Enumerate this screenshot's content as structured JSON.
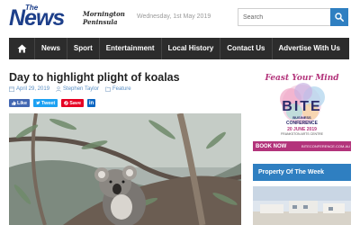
{
  "header": {
    "logo_the": "The",
    "logo_news": "News",
    "logo_region": "Mornington Peninsula",
    "date": "Wednesday, 1st May 2019",
    "search_placeholder": "Search"
  },
  "nav": {
    "items": [
      "News",
      "Sport",
      "Entertainment",
      "Local History",
      "Contact Us",
      "Advertise With Us"
    ]
  },
  "article": {
    "title": "Day to highlight plight of koalas",
    "date": "April 29, 2019",
    "author": "Stephen Taylor",
    "category": "Feature",
    "share": {
      "like": "Like",
      "tweet": "Tweet",
      "save": "Save",
      "linkedin": "in"
    }
  },
  "sidebar": {
    "ad": {
      "tagline": "Feast Your Mind",
      "name": "BITE",
      "line1": "BUSINESS",
      "line2": "CONFERENCE",
      "line3": "20 JUNE 2019",
      "line4": "FRANKSTON ARTS CENTRE",
      "book": "BOOK NOW",
      "url": "BITECONFERENCE.COM.AU"
    },
    "property_title": "Property Of The Week"
  }
}
